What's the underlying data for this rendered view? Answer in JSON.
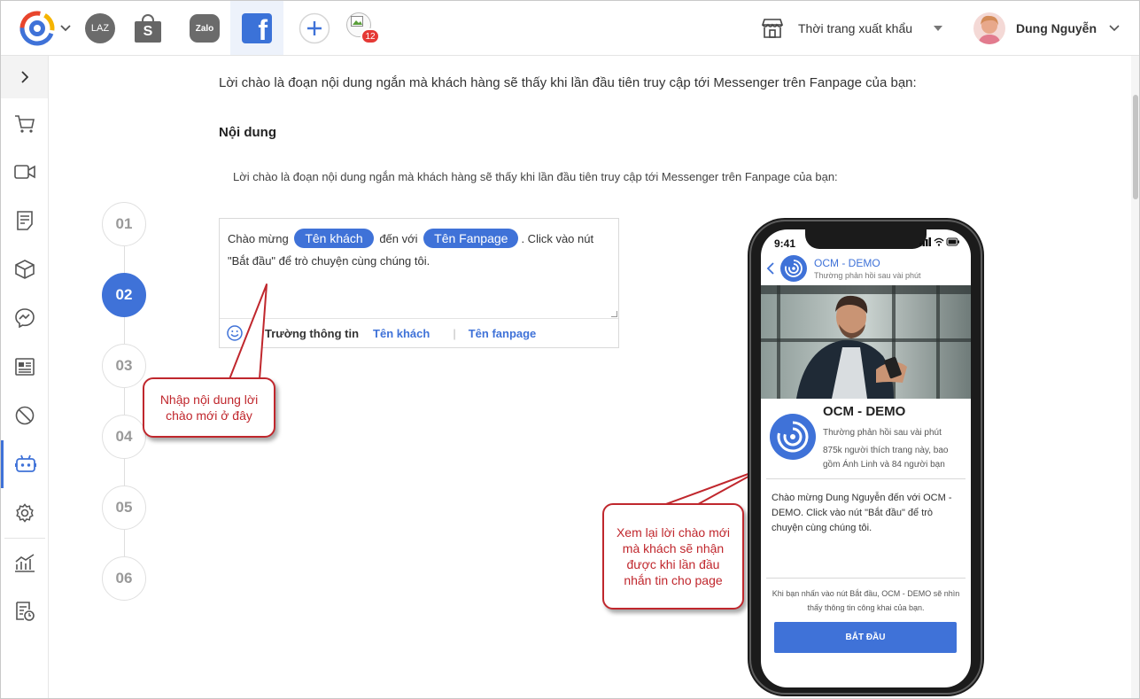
{
  "topbar": {
    "laz_label": "LAZ",
    "shopee_label": "S",
    "zalo_label": "Zalo",
    "facebook_label": "f",
    "notification_count": "12",
    "store_name": "Thời trang xuất khẩu",
    "user_name": "Dung Nguyễn"
  },
  "colors": {
    "accent": "#3f72d8",
    "callout": "#c0272d",
    "badge": "#e53935",
    "shopee": "#ee4d2d"
  },
  "sidebar": {
    "icons": [
      "cart-icon",
      "video-icon",
      "document-icon",
      "box-icon",
      "messenger-icon",
      "contact-card-icon",
      "blocked-icon",
      "bot-icon",
      "gear-icon",
      "analytics-icon",
      "report-calendar-icon"
    ],
    "active": "bot-icon"
  },
  "content": {
    "intro": "Lời chào là đoạn nội dung ngắn mà khách hàng sẽ thấy khi lần đầu tiên truy cập tới Messenger trên Fanpage của bạn:",
    "section_title": "Nội dung",
    "description": "Lời chào là đoạn nội dung ngắn mà khách hàng sẽ thấy khi lần đầu tiên truy cập tới Messenger trên Fanpage của bạn:"
  },
  "steps": [
    "01",
    "02",
    "03",
    "04",
    "05",
    "06"
  ],
  "active_step": "02",
  "editor": {
    "text_1": "Chào mừng",
    "chip_customer": "Tên khách",
    "text_2": "đến với",
    "chip_fanpage": "Tên Fanpage",
    "text_3": ". Click vào nút \"Bắt đầu\" để trò chuyện cùng chúng tôi.",
    "fields_label": "Trường thông tin",
    "field_customer": "Tên khách",
    "field_separator": "|",
    "field_fanpage": "Tên fanpage"
  },
  "callouts": {
    "editor_hint": "Nhập nội dung lời chào mới ở đây",
    "preview_hint": "Xem lại lời chào mới mà khách sẽ nhận được khi lần đầu nhắn tin cho page"
  },
  "phone": {
    "time": "9:41",
    "page_title": "OCM - DEMO",
    "response_time": "Thường phản hồi sau vài phút",
    "page_name": "OCM - DEMO",
    "page_response": "Thường phản hồi sau vài phút",
    "page_likes": "875k người thích trang này, bao gồm Ánh Linh và 84 người bạn",
    "welcome_message": "Chào mừng Dung Nguyễn đến với OCM - DEMO. Click vào nút \"Bắt đầu\" để trò chuyện cùng chúng tôi.",
    "note": "Khi bạn nhấn vào nút Bắt đầu, OCM - DEMO sẽ nhìn thấy thông tin công khai của bạn.",
    "start_button": "BẮT ĐẦU"
  }
}
